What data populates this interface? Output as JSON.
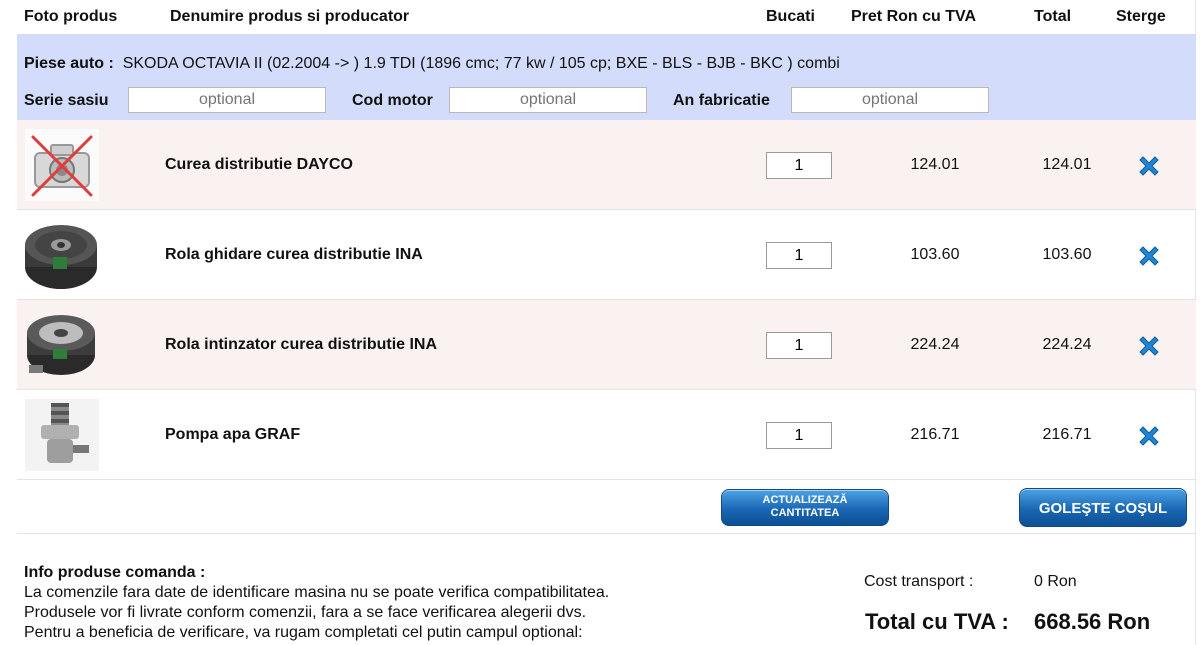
{
  "header": {
    "col_photo": "Foto produs",
    "col_name": "Denumire produs si producator",
    "col_qty": "Bucati",
    "col_price": "Pret Ron cu TVA",
    "col_total": "Total",
    "col_delete": "Sterge"
  },
  "car": {
    "label": "Piese auto :",
    "description": "SKODA OCTAVIA II  (02.2004 -> ) 1.9 TDI (1896 cmc; 77 kw / 105 cp; BXE - BLS - BJB - BKC ) combi",
    "fields": [
      {
        "label": "Serie sasiu",
        "placeholder": "optional"
      },
      {
        "label": "Cod motor",
        "placeholder": "optional"
      },
      {
        "label": "An fabricatie",
        "placeholder": "optional"
      }
    ]
  },
  "products": [
    {
      "name": "Curea distributie DAYCO",
      "qty": "1",
      "price": "124.01",
      "total": "124.01",
      "icon": "no-photo-camera-icon"
    },
    {
      "name": "Rola ghidare curea distributie INA",
      "qty": "1",
      "price": "103.60",
      "total": "103.60",
      "icon": "idler-pulley-image"
    },
    {
      "name": "Rola intinzator curea distributie INA",
      "qty": "1",
      "price": "224.24",
      "total": "224.24",
      "icon": "tensioner-pulley-image"
    },
    {
      "name": "Pompa apa GRAF",
      "qty": "1",
      "price": "216.71",
      "total": "216.71",
      "icon": "water-pump-image"
    }
  ],
  "buttons": {
    "update_line1": "ACTUALIZEAZĂ",
    "update_line2": "CANTITATEA",
    "empty": "GOLEŞTE COŞUL"
  },
  "info": {
    "title": "Info produse comanda :",
    "line1": "La comenzile fara date de identificare masina nu se poate verifica compatibilitatea.",
    "line2": "Produsele vor fi livrate conform comenzii, fara a se face verificarea alegerii dvs.",
    "line3": "Pentru a beneficia de verificare, va rugam completati cel putin campul optional:"
  },
  "summary": {
    "transport_label": "Cost transport :",
    "transport_value": "0 Ron",
    "total_label": "Total cu TVA :",
    "total_value": "668.56 Ron"
  },
  "colors": {
    "band": "#d4dcfb",
    "row_shade": "#f9f2f0",
    "button_blue": "#1a67b4",
    "delete_icon": "#1f86d1"
  }
}
